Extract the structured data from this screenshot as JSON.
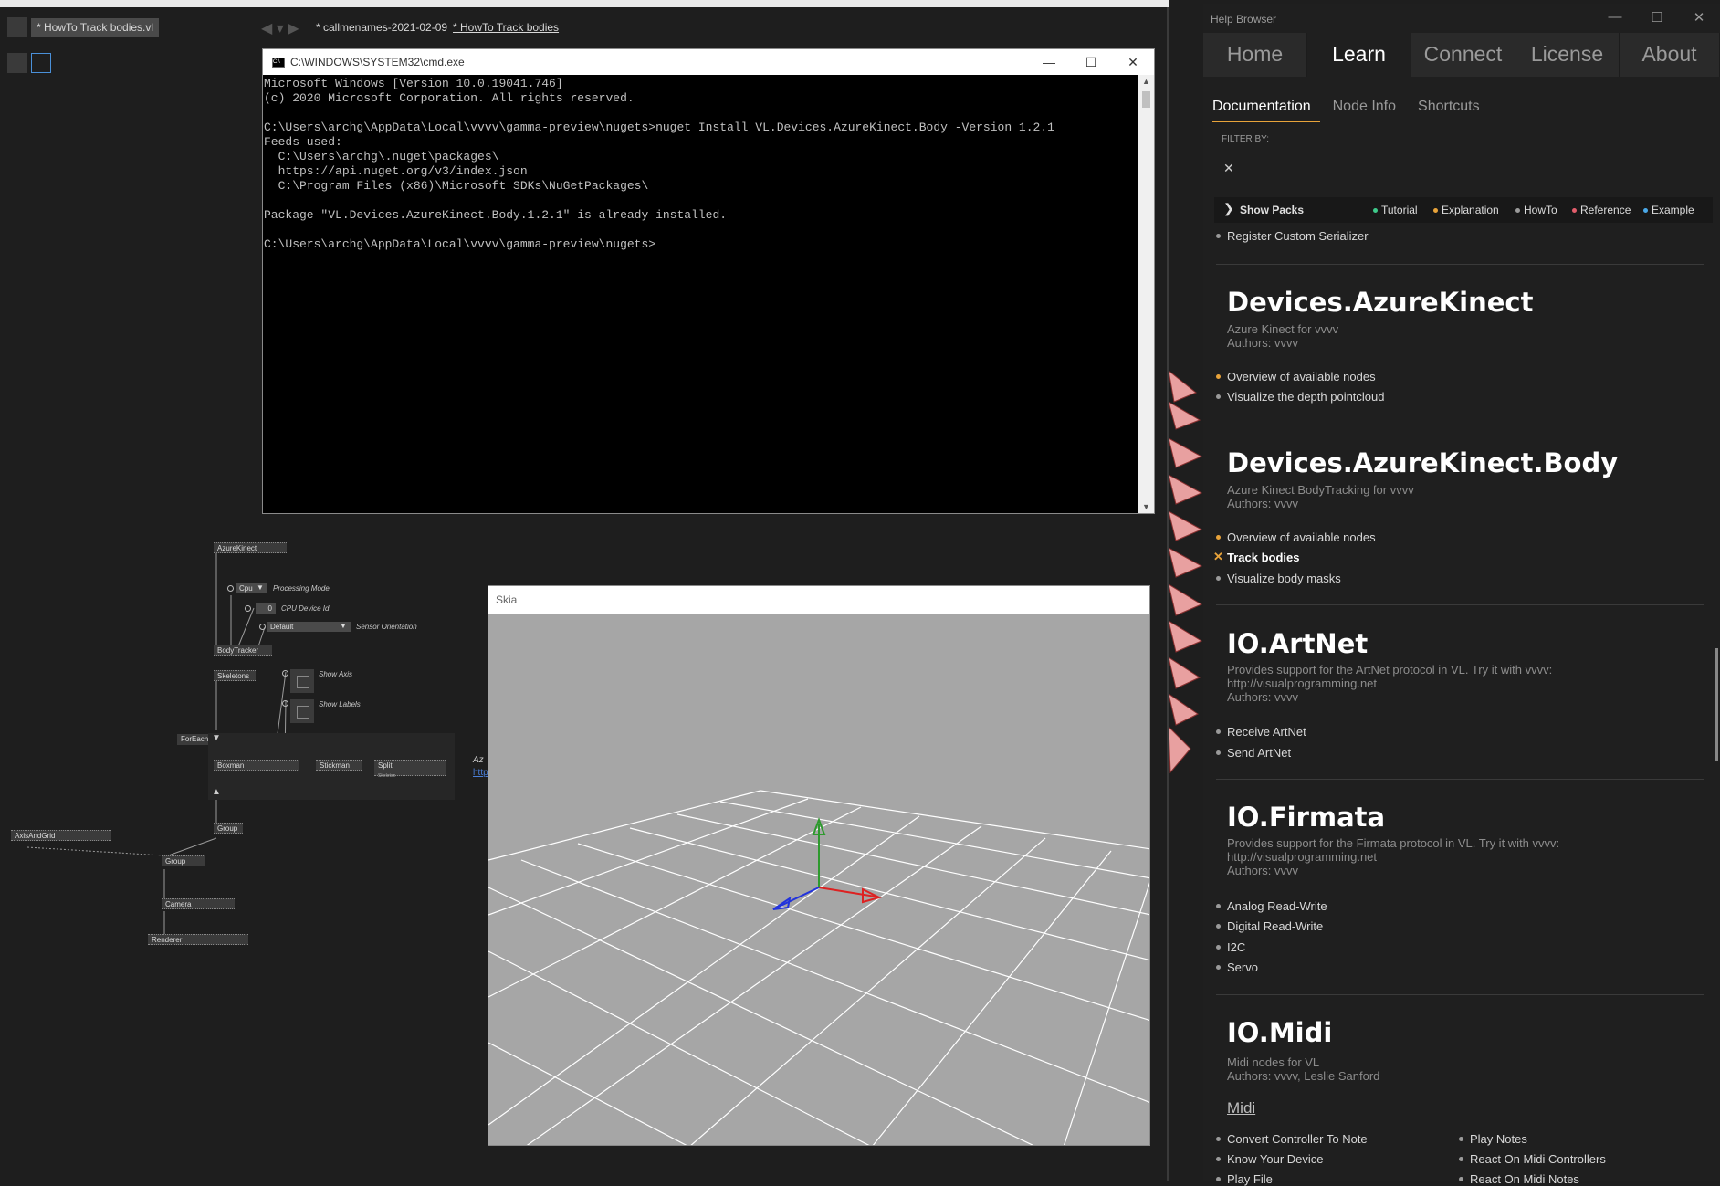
{
  "editor": {
    "document_tab": "* HowTo Track bodies.vl",
    "tabs": [
      "* callmenames-2021-02-09",
      "* HowTo Track bodies"
    ],
    "patch": {
      "nodes": [
        "AzureKinect",
        "BodyTracker",
        "Skeletons",
        "ForEach",
        "Boxman",
        "Stickman",
        "Split",
        "Group",
        "AxisAndGrid",
        "Group",
        "Camera",
        "Renderer"
      ],
      "split_sub": "Skeleton",
      "processing_value": "Cpu",
      "processing_label": "Processing Mode",
      "device_value": "0",
      "device_label": "CPU Device Id",
      "orientation_value": "Default",
      "orientation_label": "Sensor Orientation",
      "show_axis": "Show Axis",
      "show_labels": "Show Labels",
      "note_text": "Az",
      "note_link": "http"
    }
  },
  "cmd": {
    "title": "C:\\WINDOWS\\SYSTEM32\\cmd.exe",
    "lines": [
      "Microsoft Windows [Version 10.0.19041.746]",
      "(c) 2020 Microsoft Corporation. All rights reserved.",
      "",
      "C:\\Users\\archg\\AppData\\Local\\vvvv\\gamma-preview\\nugets>nuget Install VL.Devices.AzureKinect.Body -Version 1.2.1",
      "Feeds used:",
      "  C:\\Users\\archg\\.nuget\\packages\\",
      "  https://api.nuget.org/v3/index.json",
      "  C:\\Program Files (x86)\\Microsoft SDKs\\NuGetPackages\\",
      "",
      "Package \"VL.Devices.AzureKinect.Body.1.2.1\" is already installed.",
      "",
      "C:\\Users\\archg\\AppData\\Local\\vvvv\\gamma-preview\\nugets>"
    ]
  },
  "skia": {
    "title": "Skia"
  },
  "help": {
    "window_title": "Help Browser",
    "main_tabs": [
      "Home",
      "Learn",
      "Connect",
      "License",
      "About"
    ],
    "sub_tabs": [
      "Documentation",
      "Node Info",
      "Shortcuts"
    ],
    "filter_label": "FILTER BY:",
    "show_packs": "Show Packs",
    "legend": [
      {
        "label": "Tutorial",
        "color": "#3ec98a"
      },
      {
        "label": "Explanation",
        "color": "#e8a33a"
      },
      {
        "label": "HowTo",
        "color": "#9a9a9a"
      },
      {
        "label": "Reference",
        "color": "#e25d6b"
      },
      {
        "label": "Example",
        "color": "#4aa8e8"
      }
    ],
    "prev_item": "Register Custom Serializer",
    "packs": {
      "azurekinect": {
        "title": "Devices.AzureKinect",
        "desc": "Azure Kinect for vvvv",
        "authors": "Authors: vvvv",
        "items": [
          "Overview of available nodes",
          "Visualize the depth pointcloud"
        ]
      },
      "body": {
        "title": "Devices.AzureKinect.Body",
        "desc": "Azure Kinect BodyTracking for vvvv",
        "authors": "Authors: vvvv",
        "items": [
          "Overview of available nodes",
          "Track bodies",
          "Visualize body masks"
        ]
      },
      "artnet": {
        "title": "IO.ArtNet",
        "desc": "Provides support for the ArtNet protocol in VL. Try it with vvvv:",
        "desc2": "http://visualprogramming.net",
        "authors": "Authors: vvvv",
        "items": [
          "Receive ArtNet",
          "Send ArtNet"
        ]
      },
      "firmata": {
        "title": "IO.Firmata",
        "desc": "Provides support for the Firmata protocol in VL. Try it with vvvv:",
        "desc2": "http://visualprogramming.net",
        "authors": "Authors: vvvv",
        "items": [
          "Analog Read-Write",
          "Digital Read-Write",
          "I2C",
          "Servo"
        ]
      },
      "midi": {
        "title": "IO.Midi",
        "desc": "Midi nodes for VL",
        "authors": "Authors: vvvv,  Leslie Sanford",
        "section": "Midi",
        "items_left": [
          "Convert Controller To Note",
          "Know Your Device",
          "Play File"
        ],
        "items_right": [
          "Play Notes",
          "React On Midi Controllers",
          "React On Midi Notes"
        ]
      }
    }
  }
}
